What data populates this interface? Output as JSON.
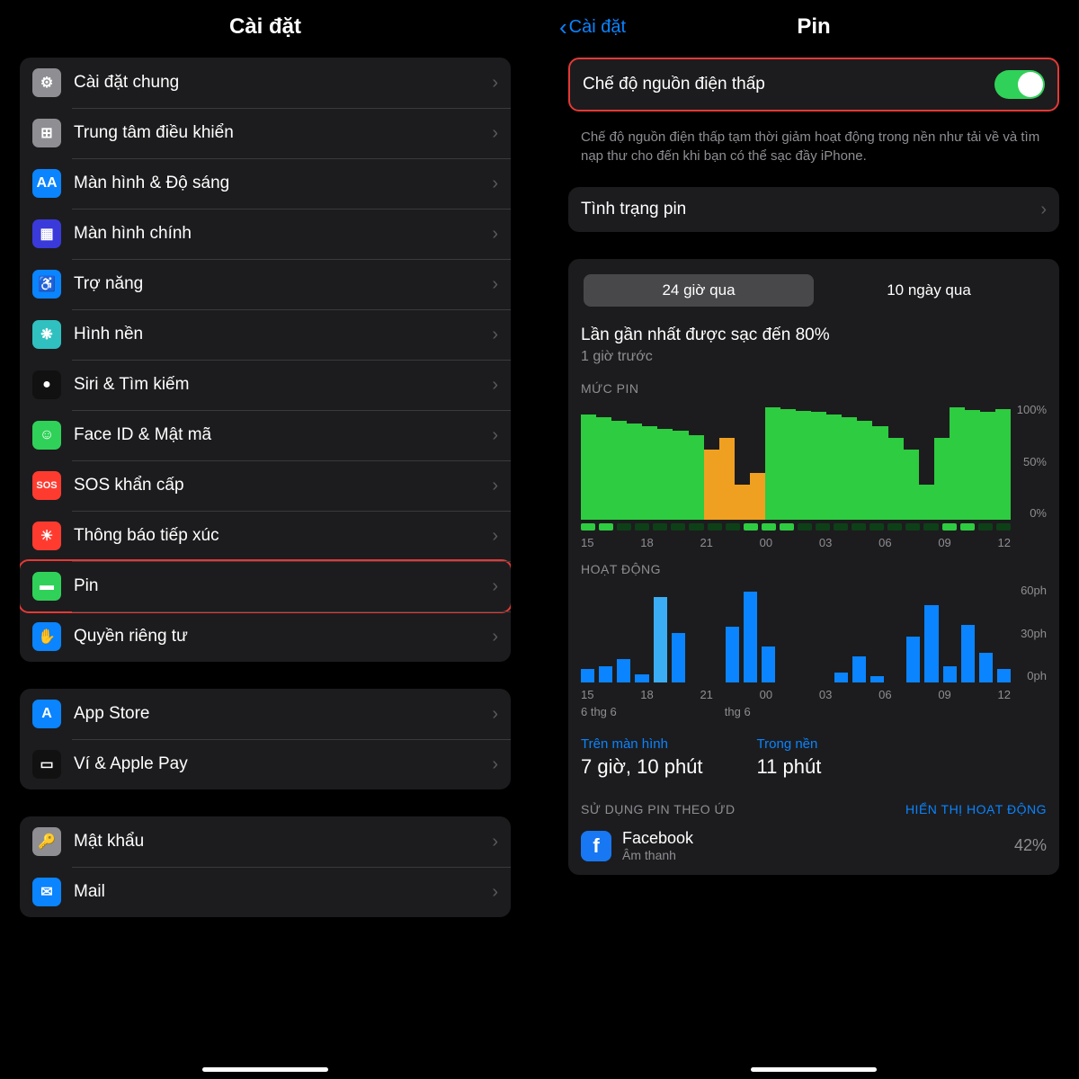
{
  "left": {
    "title": "Cài đặt",
    "group1": [
      {
        "icon": "⚙",
        "bg": "#8e8e93",
        "label": "Cài đặt chung"
      },
      {
        "icon": "⊞",
        "bg": "#8e8e93",
        "label": "Trung tâm điều khiển"
      },
      {
        "icon": "AA",
        "bg": "#0a84ff",
        "label": "Màn hình & Độ sáng"
      },
      {
        "icon": "▦",
        "bg": "#3a3adb",
        "label": "Màn hình chính"
      },
      {
        "icon": "♿",
        "bg": "#0a84ff",
        "label": "Trợ năng"
      },
      {
        "icon": "❋",
        "bg": "#30c0c0",
        "label": "Hình nền"
      },
      {
        "icon": "●",
        "bg": "#111",
        "label": "Siri & Tìm kiếm"
      },
      {
        "icon": "☺",
        "bg": "#30d158",
        "label": "Face ID & Mật mã"
      },
      {
        "icon": "SOS",
        "bg": "#ff3b30",
        "label": "SOS khẩn cấp"
      },
      {
        "icon": "☀",
        "bg": "#ff3b30",
        "label": "Thông báo tiếp xúc"
      },
      {
        "icon": "▬",
        "bg": "#30d158",
        "label": "Pin",
        "highlight": true
      },
      {
        "icon": "✋",
        "bg": "#0a84ff",
        "label": "Quyền riêng tư"
      }
    ],
    "group2": [
      {
        "icon": "A",
        "bg": "#0a84ff",
        "label": "App Store"
      },
      {
        "icon": "▭",
        "bg": "#111",
        "label": "Ví & Apple Pay"
      }
    ],
    "group3": [
      {
        "icon": "🔑",
        "bg": "#8e8e93",
        "label": "Mật khẩu"
      },
      {
        "icon": "✉",
        "bg": "#0a84ff",
        "label": "Mail"
      }
    ]
  },
  "right": {
    "back": "Cài đặt",
    "title": "Pin",
    "lowPower": {
      "label": "Chế độ nguồn điện thấp",
      "on": true
    },
    "desc": "Chế độ nguồn điện thấp tạm thời giảm hoạt động trong nền như tải về và tìm nạp thư cho đến khi bạn có thể sạc đầy iPhone.",
    "batteryHealth": "Tình trạng pin",
    "seg": {
      "a": "24 giờ qua",
      "b": "10 ngày qua"
    },
    "chargedTitle": "Lần gần nhất được sạc đến 80%",
    "chargedSub": "1 giờ trước",
    "levelTitle": "MỨC PIN",
    "actTitle": "HOẠT ĐỘNG",
    "xlabels": [
      "15",
      "18",
      "21",
      "00",
      "03",
      "06",
      "09",
      "12"
    ],
    "ylabels": [
      "100%",
      "50%",
      "0%"
    ],
    "actY": [
      "60ph",
      "30ph",
      "0ph"
    ],
    "dateA": "6 thg 6",
    "dateB": "thg 6",
    "onScreen": {
      "label": "Trên màn hình",
      "value": "7 giờ, 10 phút"
    },
    "bg": {
      "label": "Trong nền",
      "value": "11 phút"
    },
    "appsTitle": "SỬ DỤNG PIN THEO ỨD",
    "appsLink": "HIỂN THỊ HOẠT ĐỘNG",
    "app": {
      "name": "Facebook",
      "sub": "Âm thanh",
      "pct": "42%"
    }
  },
  "chart_data": {
    "type": "bar",
    "title": "Battery level and activity over 24h",
    "battery_level": {
      "x_ticks": [
        "15",
        "18",
        "21",
        "00",
        "03",
        "06",
        "09",
        "12"
      ],
      "ylim": [
        0,
        100
      ],
      "values_pct": [
        90,
        88,
        85,
        82,
        80,
        78,
        76,
        72,
        60,
        70,
        30,
        40,
        96,
        95,
        93,
        92,
        90,
        88,
        85,
        80,
        70,
        60,
        30,
        70,
        96,
        94,
        92,
        95
      ]
    },
    "activity_minutes": {
      "x_ticks": [
        "15",
        "18",
        "21",
        "00",
        "03",
        "06",
        "09",
        "12"
      ],
      "ylim": [
        0,
        60
      ],
      "values": [
        8,
        10,
        14,
        5,
        52,
        30,
        0,
        0,
        34,
        55,
        22,
        0,
        0,
        0,
        6,
        16,
        4,
        0,
        28,
        47,
        10,
        35,
        18,
        8
      ]
    }
  }
}
